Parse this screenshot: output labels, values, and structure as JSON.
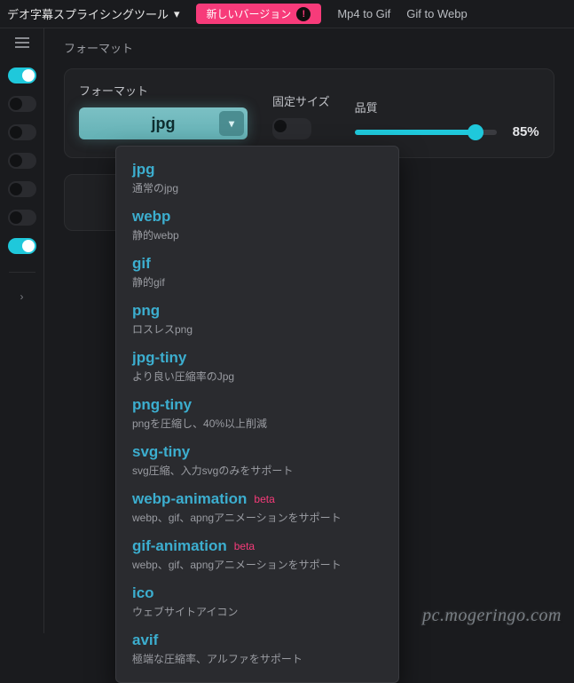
{
  "topbar": {
    "title": "デオ字幕スプライシングツール",
    "new_version_label": "新しいバージョン",
    "nav1": "Mp4 to Gif",
    "nav2": "Gif to Webp"
  },
  "sidebar": {
    "toggles": [
      {
        "on": true
      },
      {
        "on": false
      },
      {
        "on": false
      },
      {
        "on": false
      },
      {
        "on": false
      },
      {
        "on": false
      },
      {
        "on": true
      }
    ]
  },
  "section_title": "フォーマット",
  "format": {
    "label": "フォーマット",
    "selected": "jpg"
  },
  "fixed_size": {
    "label": "固定サイズ",
    "on": false
  },
  "quality": {
    "label": "品質",
    "value": "85%"
  },
  "dropdown": [
    {
      "name": "jpg",
      "desc": "通常のjpg",
      "beta": ""
    },
    {
      "name": "webp",
      "desc": "静的webp",
      "beta": ""
    },
    {
      "name": "gif",
      "desc": "静的gif",
      "beta": ""
    },
    {
      "name": "png",
      "desc": "ロスレスpng",
      "beta": ""
    },
    {
      "name": "jpg-tiny",
      "desc": "より良い圧縮率のJpg",
      "beta": ""
    },
    {
      "name": "png-tiny",
      "desc": "pngを圧縮し、40%以上削減",
      "beta": ""
    },
    {
      "name": "svg-tiny",
      "desc": "svg圧縮、入力svgのみをサポート",
      "beta": ""
    },
    {
      "name": "webp-animation",
      "desc": "webp、gif、apngアニメーションをサポート",
      "beta": "beta"
    },
    {
      "name": "gif-animation",
      "desc": "webp、gif、apngアニメーションをサポート",
      "beta": "beta"
    },
    {
      "name": "ico",
      "desc": "ウェブサイトアイコン",
      "beta": ""
    },
    {
      "name": "avif",
      "desc": "極端な圧縮率、アルファをサポート",
      "beta": ""
    }
  ],
  "watermark": "pc.mogeringo.com"
}
